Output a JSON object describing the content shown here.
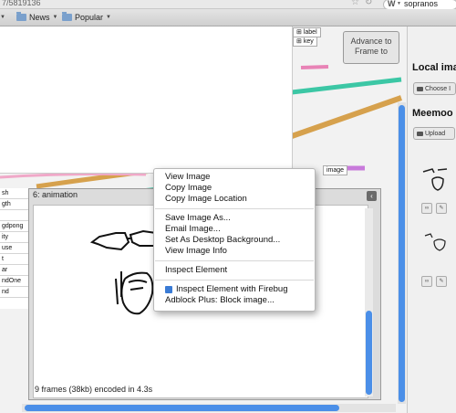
{
  "browser": {
    "url_fragment": "7/5819136",
    "search_query": "sopranos",
    "search_engine_icon": "W"
  },
  "bookmarks": [
    {
      "label": "News"
    },
    {
      "label": "Popular"
    }
  ],
  "graph": {
    "node_label_1": "label",
    "node_label_2": "key",
    "image_tag": "image",
    "advance_button": "Advance to Frame to"
  },
  "left_list": [
    "sh",
    "gth",
    "",
    "gdpong",
    "ity",
    "use",
    "t",
    "ar",
    "ndOne",
    "nd"
  ],
  "panel": {
    "title": "6: animation",
    "collapse_icon": "‹",
    "status": "9 frames (38kb) encoded in 4.3s"
  },
  "right_panel": {
    "local_heading": "Local ima",
    "choose_button": "Choose I",
    "meemoo_heading": "Meemoo",
    "upload_button": "Upload"
  },
  "context_menu": {
    "group1": [
      "View Image",
      "Copy Image",
      "Copy Image Location"
    ],
    "group2": [
      "Save Image As...",
      "Email Image...",
      "Set As Desktop Background...",
      "View Image Info"
    ],
    "group3": [
      "Inspect Element"
    ],
    "group4": [
      "Inspect Element with Firebug",
      "Adblock Plus: Block image..."
    ]
  },
  "colors": {
    "accent_blue": "#4b8fe8",
    "wire_teal": "#3cc7a5",
    "wire_orange": "#d6a14d",
    "wire_pink": "#e883b6"
  }
}
